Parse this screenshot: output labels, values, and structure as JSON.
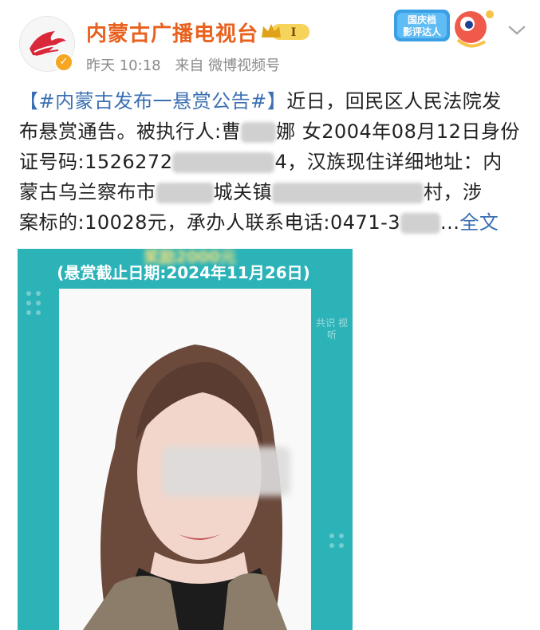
{
  "account": {
    "name": "内蒙古广播电视台",
    "level_label": "I",
    "post_time": "昨天 10:18",
    "post_source": "来自 微博视频号"
  },
  "badge": {
    "line1": "国庆档",
    "line2": "影评达人"
  },
  "post": {
    "topic": "【#内蒙古发布一悬赏公告#】",
    "line1_rest": "近日，回民区人民法院发",
    "line2_a": "布悬赏通告。被执行人:曹",
    "line2_b": "娜 女2004年08月12日身份",
    "line3_a": "证号码:1526272",
    "line3_b": "4，汉族现住详细地址：内",
    "line4_a": "蒙古乌兰察布市",
    "line4_b": "城关镇",
    "line4_c": "村，涉",
    "line5_a": "案标的:10028元，承办人联系电话:0471-3",
    "line5_b": "...",
    "more_label": "全文"
  },
  "poster": {
    "heading": "奖励2000元",
    "deadline": "(悬赏截止日期:2024年11月26日)",
    "watermark": "共识 视听"
  },
  "colors": {
    "brand_orange": "#e8611e",
    "link_blue": "#3b6fb3",
    "poster_teal": "#2cb3b8",
    "verify_gold": "#f5a623"
  },
  "icons": {
    "avatar": "tv-station-logo",
    "verify": "verified-badge-icon",
    "level": "crown-level-icon",
    "menu": "chevron-down-icon"
  }
}
